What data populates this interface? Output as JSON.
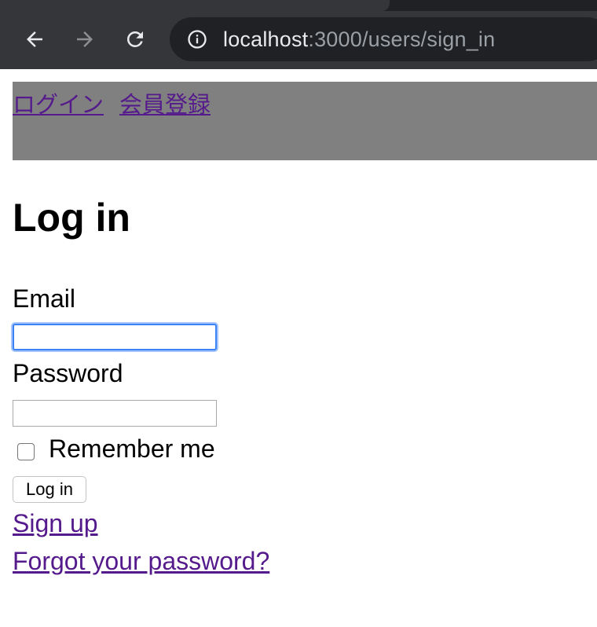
{
  "browser": {
    "url_host": "localhost",
    "url_path": ":3000/users/sign_in",
    "icons": {
      "back": "arrow-left-icon",
      "forward": "arrow-right-icon",
      "reload": "reload-icon",
      "site_info": "info-icon"
    },
    "chrome_color": "#35363a"
  },
  "header": {
    "login_link": "ログイン",
    "register_link": "会員登録",
    "background": "#808080"
  },
  "form": {
    "title": "Log in",
    "email_label": "Email",
    "email_value": "",
    "password_label": "Password",
    "password_value": "",
    "remember_label": "Remember me",
    "remember_checked": false,
    "submit_label": "Log in"
  },
  "links": {
    "sign_up": "Sign up",
    "forgot_password": "Forgot your password?",
    "link_color": "#551a8b"
  }
}
